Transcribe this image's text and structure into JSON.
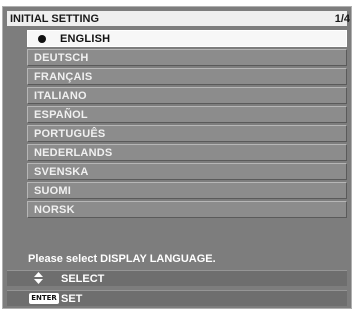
{
  "header": {
    "title": "INITIAL SETTING",
    "page_indicator": "1/4"
  },
  "languages": [
    {
      "label": "ENGLISH",
      "selected": true
    },
    {
      "label": "DEUTSCH",
      "selected": false
    },
    {
      "label": "FRANÇAIS",
      "selected": false
    },
    {
      "label": "ITALIANO",
      "selected": false
    },
    {
      "label": "ESPAÑOL",
      "selected": false
    },
    {
      "label": "PORTUGUÊS",
      "selected": false
    },
    {
      "label": "NEDERLANDS",
      "selected": false
    },
    {
      "label": "SVENSKA",
      "selected": false
    },
    {
      "label": "SUOMI",
      "selected": false
    },
    {
      "label": "NORSK",
      "selected": false
    }
  ],
  "message": "Please select DISPLAY LANGUAGE.",
  "footer": {
    "select_label": "SELECT",
    "select_icon": "up-down-arrows-icon",
    "enter_key": "ENTER",
    "set_label": "SET"
  },
  "colors": {
    "panel_background": "#7d7d7d",
    "item_background": "#8c8c8c",
    "selected_background": "#f7f7f7",
    "header_background": "#efefef"
  }
}
